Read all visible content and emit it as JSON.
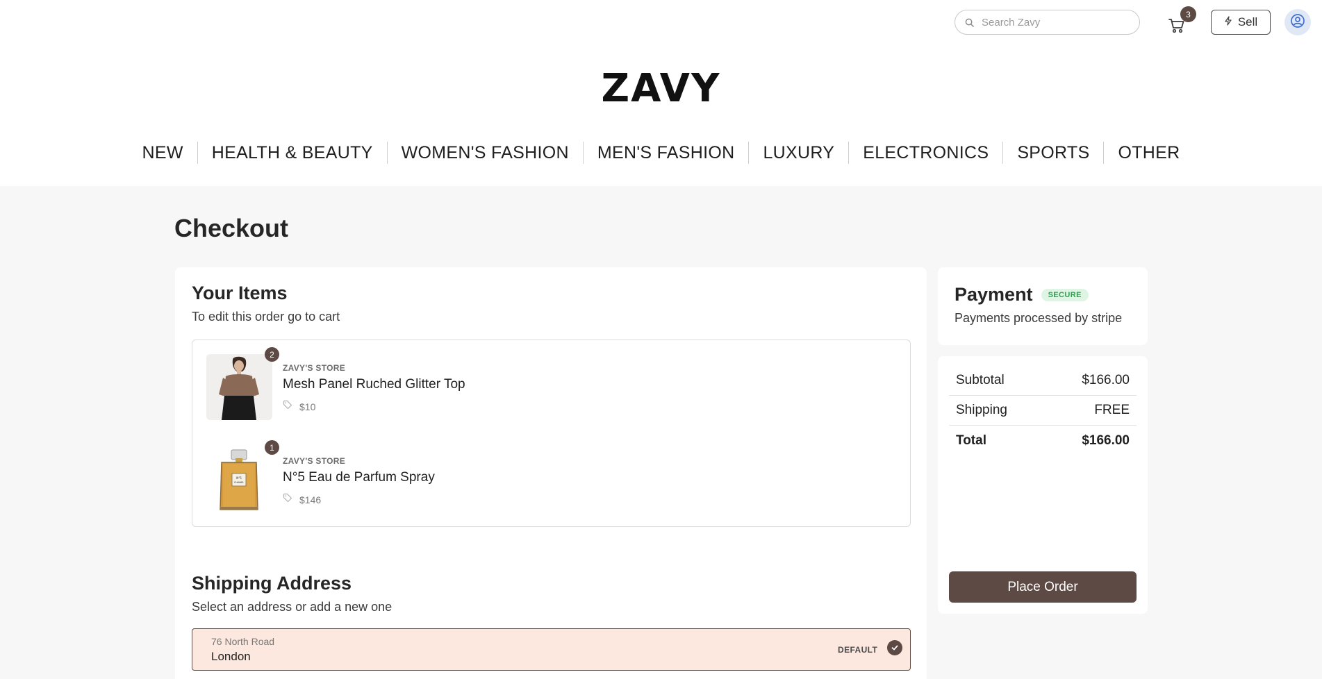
{
  "header": {
    "search_placeholder": "Search Zavy",
    "cart_count": "3",
    "sell_label": "Sell",
    "logo": "ZAVY"
  },
  "nav": {
    "items": [
      "NEW",
      "HEALTH & BEAUTY",
      "WOMEN'S FASHION",
      "MEN'S FASHION",
      "LUXURY",
      "ELECTRONICS",
      "SPORTS",
      "OTHER"
    ]
  },
  "page": {
    "title": "Checkout"
  },
  "items_section": {
    "title": "Your Items",
    "subtitle": "To edit this order go to cart",
    "items": [
      {
        "qty": "2",
        "store": "ZAVY'S STORE",
        "name": "Mesh Panel Ruched Glitter Top",
        "price": "$10"
      },
      {
        "qty": "1",
        "store": "ZAVY'S STORE",
        "name": "N°5 Eau de Parfum Spray",
        "price": "$146"
      }
    ]
  },
  "shipping": {
    "title": "Shipping Address",
    "subtitle": "Select an address or add a new one",
    "address": {
      "line1": "76 North Road",
      "city": "London",
      "tag": "DEFAULT"
    }
  },
  "payment": {
    "title": "Payment",
    "badge": "SECURE",
    "subtitle": "Payments processed by stripe"
  },
  "summary": {
    "subtotal_label": "Subtotal",
    "subtotal_value": "$166.00",
    "shipping_label": "Shipping",
    "shipping_value": "FREE",
    "total_label": "Total",
    "total_value": "$166.00",
    "place_order_label": "Place Order"
  },
  "colors": {
    "brand": "#5e4a44",
    "address_selected_bg": "#fde8df",
    "secure_badge_bg": "#dff5e4",
    "secure_badge_text": "#2f9e4f"
  }
}
